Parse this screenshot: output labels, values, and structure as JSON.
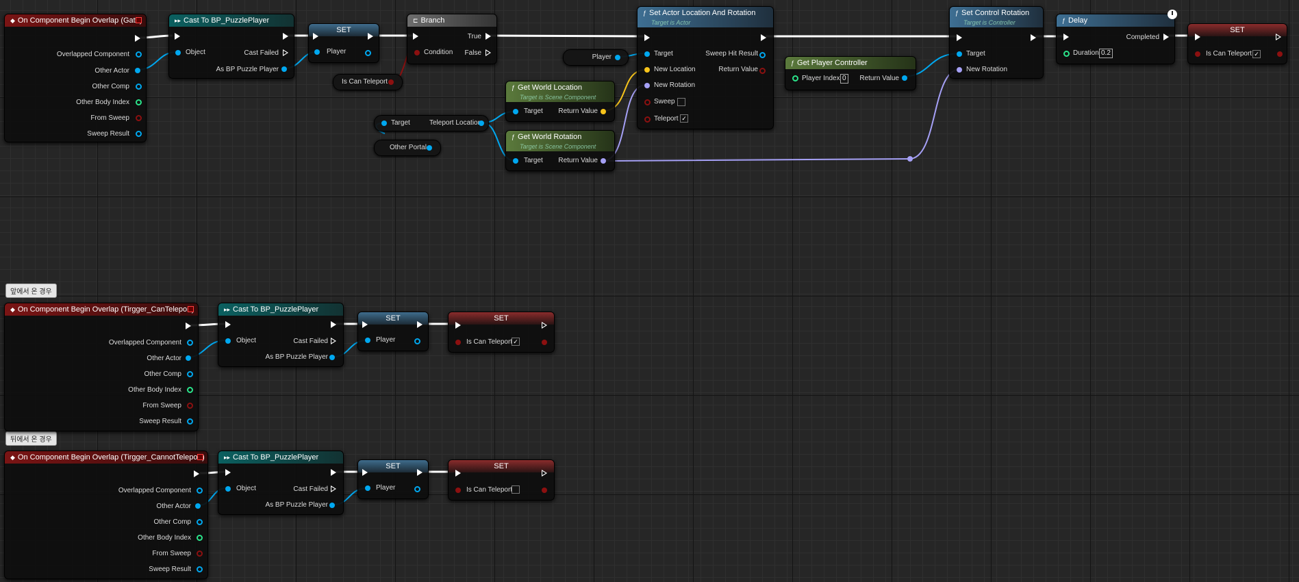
{
  "comments": [
    "앞에서 온 경우",
    "뒤에서 온 경우"
  ],
  "gate_event": {
    "title": "On Component Begin Overlap (Gate)",
    "pins": [
      "Overlapped Component",
      "Other Actor",
      "Other Comp",
      "Other Body Index",
      "From Sweep",
      "Sweep Result"
    ]
  },
  "cast_node": {
    "title": "Cast To BP_PuzzlePlayer",
    "object": "Object",
    "cast_failed": "Cast Failed",
    "as_player": "As BP Puzzle Player"
  },
  "set_player": {
    "title": "SET",
    "pin": "Player"
  },
  "branch": {
    "title": "Branch",
    "true": "True",
    "false": "False",
    "condition": "Condition"
  },
  "var_is_can_teleport": "Is Can Teleport",
  "var_player": "Player",
  "var_teleport_location": {
    "target": "Target",
    "label": "Teleport Location"
  },
  "var_other_portal": "Other Portal",
  "get_world_location": {
    "title": "Get World Location",
    "sub": "Target is Scene Component",
    "target": "Target",
    "ret": "Return Value"
  },
  "get_world_rotation": {
    "title": "Get World Rotation",
    "sub": "Target is Scene Component",
    "target": "Target",
    "ret": "Return Value"
  },
  "set_actor_loc_rot": {
    "title": "Set Actor Location And Rotation",
    "sub": "Target is Actor",
    "target": "Target",
    "new_location": "New Location",
    "new_rotation": "New Rotation",
    "sweep": "Sweep",
    "teleport": "Teleport",
    "sweep_hit": "Sweep Hit Result",
    "ret": "Return Value",
    "teleport_checked": "✓"
  },
  "get_player_controller": {
    "title": "Get Player Controller",
    "player_index": "Player Index",
    "index_value": "0",
    "ret": "Return Value"
  },
  "set_control_rotation": {
    "title": "Set Control Rotation",
    "sub": "Target is Controller",
    "target": "Target",
    "new_rotation": "New Rotation"
  },
  "delay": {
    "title": "Delay",
    "completed": "Completed",
    "duration": "Duration",
    "duration_value": "0.2"
  },
  "set_teleport_1": {
    "title": "SET",
    "pin": "Is Can Teleport",
    "checked": "✓"
  },
  "can_event": {
    "title": "On Component Begin Overlap (Tirgger_CanTeleport)",
    "pins": [
      "Overlapped Component",
      "Other Actor",
      "Other Comp",
      "Other Body Index",
      "From Sweep",
      "Sweep Result"
    ]
  },
  "set_teleport_2": {
    "title": "SET",
    "pin": "Is Can Teleport",
    "checked": "✓"
  },
  "cannot_event": {
    "title": "On Component Begin Overlap (Tirgger_CannotTeleport)",
    "pins": [
      "Overlapped Component",
      "Other Actor",
      "Other Comp",
      "Other Body Index",
      "From Sweep",
      "Sweep Result"
    ]
  },
  "set_teleport_3": {
    "title": "SET",
    "pin": "Is Can Teleport",
    "checked": ""
  },
  "colors": {
    "exec": "#ffffff",
    "object": "#00a8f0",
    "bool": "#8c1010",
    "vector": "#f7c41b",
    "rotator": "#a5a0f5",
    "int": "#2be58b"
  }
}
